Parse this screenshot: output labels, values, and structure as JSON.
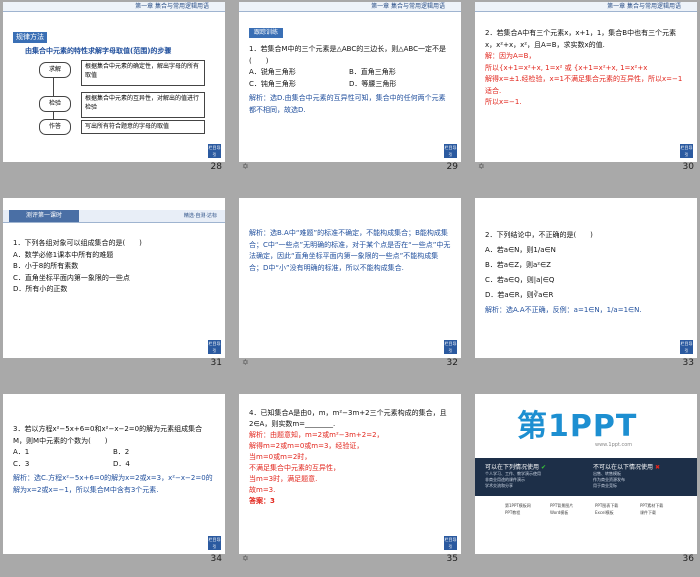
{
  "header_text": "第一章  集合与常用逻辑用语",
  "badge_text": "栏目导引",
  "note_icon": "✡",
  "slides": [
    {
      "number": "28",
      "tag": "规律方法",
      "heading": "由集合中元素的特性求解字母取值(范围)的步骤",
      "steps": [
        {
          "label": "求解",
          "text": "根据集合中元素的确定性，解出字母的所有取值"
        },
        {
          "label": "检验",
          "text": "根据集合中元素的互异性，对解出的值进行检验"
        },
        {
          "label": "作答",
          "text": "写出所有符合题意的字母的取值"
        }
      ]
    },
    {
      "number": "29",
      "tag": "跟踪训练",
      "q": "1．若集合M中的三个元素是△ABC的三边长，则△ABC一定不是(　　)",
      "opts": [
        "A．锐角三角形",
        "B．直角三角形",
        "C．钝角三角形",
        "D．等腰三角形"
      ],
      "ans": "解析：选D.由集合中元素的互异性可知，集合中的任何两个元素都不相同，故选D."
    },
    {
      "number": "30",
      "q": "2．若集合A中有三个元素x，x+1，1，集合B中也有三个元素x，x²+x，x²，且A=B，求实数x的值.",
      "ans_lines": [
        "解：因为A=B，",
        "所以{x+1=x²+x, 1=x²  或 {x+1=x²+x, 1=x²+x",
        "解得x=±1.经检验，x=1不满足集合元素的互异性，所以x=−1适合.",
        "所以x=−1."
      ]
    },
    {
      "number": "31",
      "tag": "测评第一课时",
      "tag2": "精选·自测·达标",
      "q": "1．下列各组对象可以组成集合的是(　　)",
      "opts": [
        "A．数学必修1课本中所有的难题",
        "B．小于8的所有素数",
        "C．直角坐标平面内第一象限的一些点",
        "D．所有小的正数"
      ]
    },
    {
      "number": "32",
      "ans": "解析：选B.A中“难题”的标准不确定，不能构成集合；B能构成集合；C中“一些点”无明确的标准，对于某个点是否在“一些点”中无法确定，因此“直角坐标平面内第一象限的一些点”不能构成集合；D中“小”没有明确的标准，所以不能构成集合."
    },
    {
      "number": "33",
      "q": "2．下列结论中，不正确的是(　　)",
      "opts": [
        "A．若a∈N，则1/a∈N",
        "B．若a∈Z，则a²∈Z",
        "C．若a∈Q，则|a|∈Q",
        "D．若a∈R，则∛a∈R"
      ],
      "ans": "解析：选A.A不正确，反例：a=1∈N，1/a=1∈N."
    },
    {
      "number": "34",
      "q": "3．若以方程x²−5x+6=0和x²−x−2=0的解为元素组成集合M，则M中元素的个数为(　　)",
      "opts": [
        "A．1",
        "B．2",
        "C．3",
        "D．4"
      ],
      "ans": "解析：选C.方程x²−5x+6=0的解为x=2或x=3，x²−x−2=0的解为x=2或x=−1，所以集合M中含有3个元素."
    },
    {
      "number": "35",
      "q": "4．已知集合A是由0，m，m²−3m+2三个元素构成的集合，且2∈A，则实数m=________.",
      "ans_lines": [
        "解析：由题意知，m=2或m²−3m+2=2，",
        "解得m=2或m=0或m=3，经验证，",
        "当m=0或m=2时，",
        "不满足集合中元素的互异性，",
        "当m=3时，满足题意.",
        "故m=3."
      ],
      "final": "答案：3"
    },
    {
      "number": "36",
      "logo": "第1PPT",
      "site": "www.1ppt.com",
      "allowed_title": "可以在下列情况使用",
      "not_allowed_title": "不可以在以下情况使用",
      "allowed": [
        "个人学习、工作、教学演示使用",
        "非商业用途的课件演示",
        "学术交流和分享"
      ],
      "not_allowed": [
        "出售、转售模板",
        "作为商业资源发布",
        "用于商业竞标"
      ],
      "links": [
        "第1PPT模板网",
        "PPT背景图片",
        "PPT图表下载",
        "PPT素材下载",
        "PPT教程",
        "Word模板",
        "Excel模板",
        "课件下载"
      ]
    }
  ]
}
